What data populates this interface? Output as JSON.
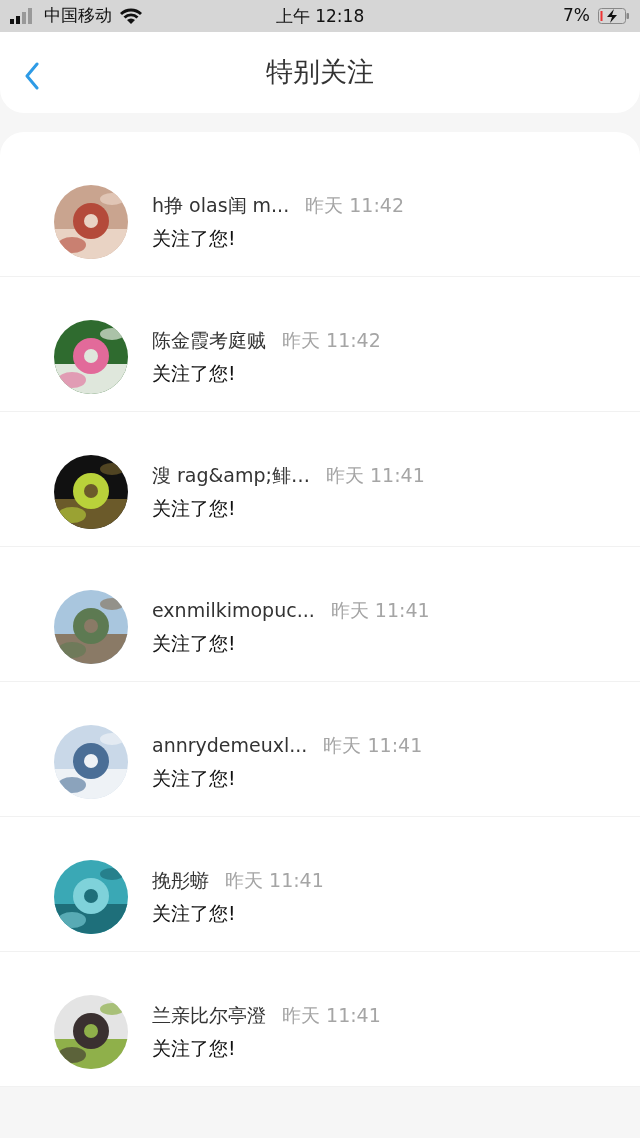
{
  "status_bar": {
    "carrier": "中国移动",
    "time": "上午 12:18",
    "battery": "7%"
  },
  "header": {
    "title": "特别关注"
  },
  "notifications": [
    {
      "name": "h挣 olas闺 m...",
      "time": "昨天 11:42",
      "message": "关注了您!"
    },
    {
      "name": "陈金霞考庭贼",
      "time": "昨天 11:42",
      "message": "关注了您!"
    },
    {
      "name": "溲 rag&amp;鲱…",
      "time": "昨天 11:41",
      "message": "关注了您!"
    },
    {
      "name": "exnmilkimopuc...",
      "time": "昨天 11:41",
      "message": "关注了您!"
    },
    {
      "name": "annrydemeuxl...",
      "time": "昨天 11:41",
      "message": "关注了您!"
    },
    {
      "name": "挽彤蝣",
      "time": "昨天 11:41",
      "message": "关注了您!"
    },
    {
      "name": "兰亲比尔亭澄",
      "time": "昨天 11:41",
      "message": "关注了您!"
    }
  ]
}
